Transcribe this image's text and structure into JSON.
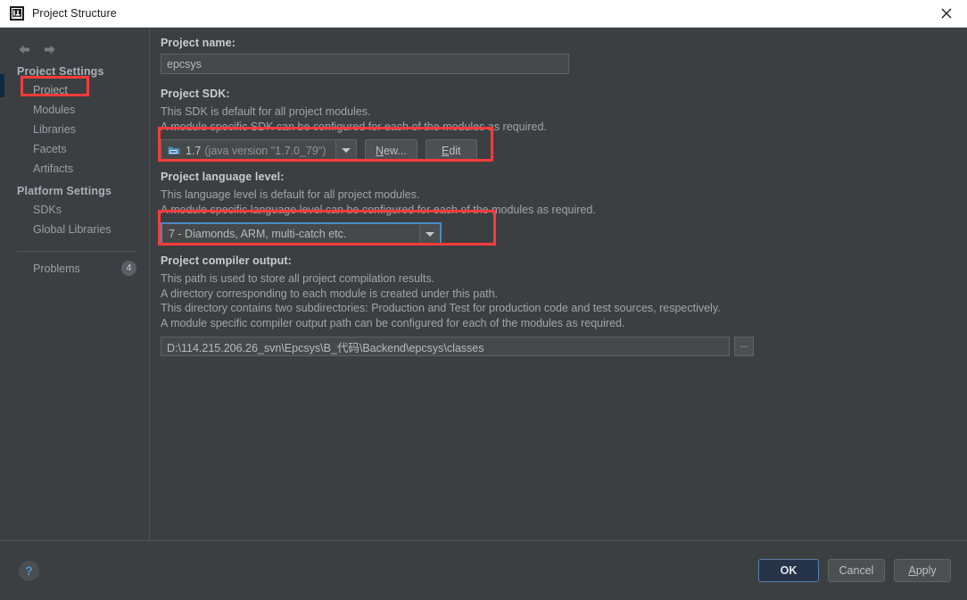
{
  "window": {
    "title": "Project Structure",
    "icon": "intellij-idea-logo-icon",
    "close_icon": "close-icon"
  },
  "sidebar": {
    "nav_back_icon": "arrow-left-icon",
    "nav_forward_icon": "arrow-right-icon",
    "groups": [
      {
        "title": "Project Settings",
        "items": [
          {
            "label": "Project",
            "selected": true
          },
          {
            "label": "Modules",
            "selected": false
          },
          {
            "label": "Libraries",
            "selected": false
          },
          {
            "label": "Facets",
            "selected": false
          },
          {
            "label": "Artifacts",
            "selected": false
          }
        ]
      },
      {
        "title": "Platform Settings",
        "items": [
          {
            "label": "SDKs",
            "selected": false
          },
          {
            "label": "Global Libraries",
            "selected": false
          }
        ]
      }
    ],
    "problems": {
      "label": "Problems",
      "count": "4"
    }
  },
  "main": {
    "project_name": {
      "label": "Project name:",
      "value": "epcsys"
    },
    "project_sdk": {
      "label": "Project SDK:",
      "desc_line1": "This SDK is default for all project modules.",
      "desc_line2": "A module specific SDK can be configured for each of the modules as required.",
      "sdk_icon": "java-sdk-icon",
      "value_version": "1.7",
      "value_detail": "(java version \"1.7.0_79\")",
      "dropdown_icon": "chevron-down-icon",
      "new_button": "New...",
      "new_button_mnemonic": "N",
      "new_button_rest": "ew...",
      "edit_button": "Edit",
      "edit_button_mnemonic": "E",
      "edit_button_rest": "dit"
    },
    "language_level": {
      "label": "Project language level:",
      "desc_line1": "This language level is default for all project modules.",
      "desc_line2": "A module specific language level can be configured for each of the modules as required.",
      "value": "7 - Diamonds, ARM, multi-catch etc.",
      "dropdown_icon": "chevron-down-icon"
    },
    "compiler_output": {
      "label": "Project compiler output:",
      "desc_line1": "This path is used to store all project compilation results.",
      "desc_line2": "A directory corresponding to each module is created under this path.",
      "desc_line3": "This directory contains two subdirectories: Production and Test for production code and test sources, respectively.",
      "desc_line4": "A module specific compiler output path can be configured for each of the modules as required.",
      "value": "D:\\114.215.206.26_svn\\Epcsys\\B_代码\\Backend\\epcsys\\classes",
      "browse_button": "...",
      "browse_icon": "ellipsis-icon"
    }
  },
  "footer": {
    "help_icon": "help-question-icon",
    "help_label": "?",
    "ok": "OK",
    "cancel": "Cancel",
    "apply_mnemonic": "A",
    "apply_rest": "pply"
  },
  "annotations": {
    "accent_color": "#fb3b3b",
    "boxes": [
      "project-sidebar-item",
      "project-sdk-row",
      "project-language-level-row"
    ]
  }
}
